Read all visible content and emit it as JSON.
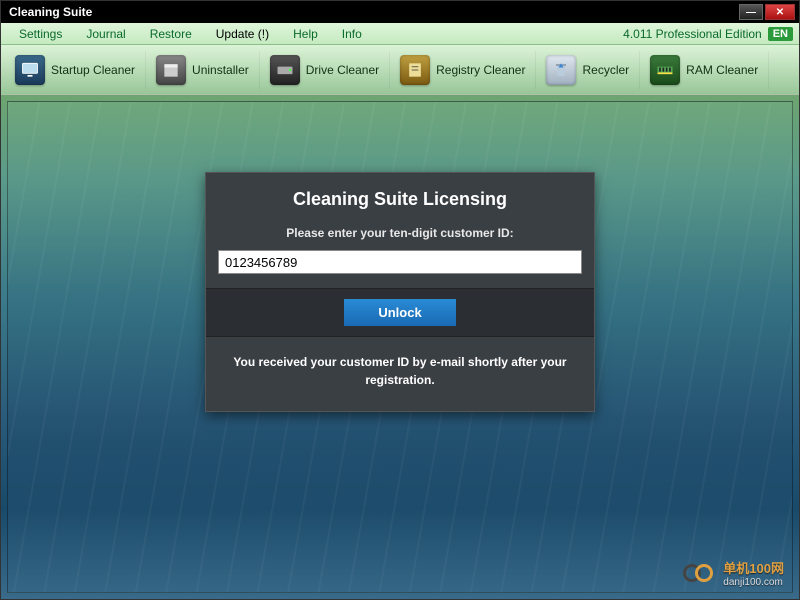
{
  "window": {
    "title": "Cleaning Suite"
  },
  "menu": {
    "settings": "Settings",
    "journal": "Journal",
    "restore": "Restore",
    "update": "Update (!)",
    "help": "Help",
    "info": "Info",
    "edition": "4.011 Professional Edition",
    "lang": "EN"
  },
  "toolbar": {
    "startup": "Startup Cleaner",
    "uninstaller": "Uninstaller",
    "drive": "Drive Cleaner",
    "registry": "Registry Cleaner",
    "recycler": "Recycler",
    "ram": "RAM Cleaner"
  },
  "licensing": {
    "title": "Cleaning Suite Licensing",
    "prompt": "Please enter your ten-digit customer ID:",
    "input_value": "0123456789",
    "unlock": "Unlock",
    "note": "You received your customer ID by e-mail shortly after your registration."
  },
  "watermark": {
    "main": "单机100网",
    "sub": "danji100.com"
  }
}
